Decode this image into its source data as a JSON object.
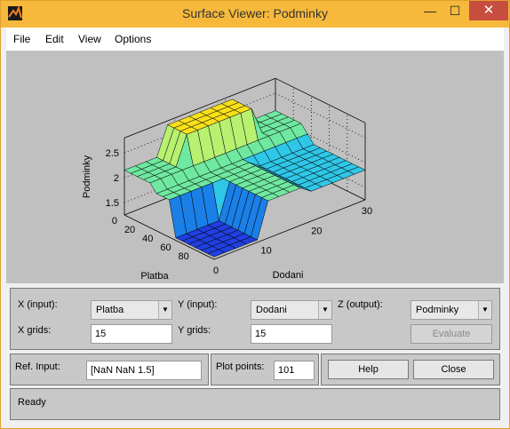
{
  "window": {
    "title": "Surface Viewer: Podminky",
    "controls": {
      "minimize": "—",
      "maximize": "☐",
      "close": "✕"
    }
  },
  "menu": [
    {
      "label": "File"
    },
    {
      "label": "Edit"
    },
    {
      "label": "View"
    },
    {
      "label": "Options"
    }
  ],
  "plot": {
    "zlabel": "Podminky",
    "xlabel": "Platba",
    "ylabel": "Dodani",
    "z_ticks": [
      "2.5",
      "2",
      "1.5"
    ],
    "platba_ticks": [
      "0",
      "20",
      "40",
      "60",
      "80"
    ],
    "dodani_ticks": [
      "0",
      "10",
      "20",
      "30"
    ],
    "colormap": [
      "#1f3fe0",
      "#1a7fe6",
      "#2fc7e8",
      "#6fe8a0",
      "#b8f070",
      "#f8e01a"
    ]
  },
  "controls": {
    "x_input_label": "X (input):",
    "x_input_value": "Platba",
    "y_input_label": "Y (input):",
    "y_input_value": "Dodani",
    "z_output_label": "Z (output):",
    "z_output_value": "Podminky",
    "x_grids_label": "X grids:",
    "x_grids_value": "15",
    "y_grids_label": "Y grids:",
    "y_grids_value": "15",
    "evaluate_label": "Evaluate",
    "ref_input_label": "Ref. Input:",
    "ref_input_value": "[NaN NaN 1.5]",
    "plot_points_label": "Plot points:",
    "plot_points_value": "101",
    "help_label": "Help",
    "close_label": "Close"
  },
  "status": {
    "text": "Ready"
  }
}
